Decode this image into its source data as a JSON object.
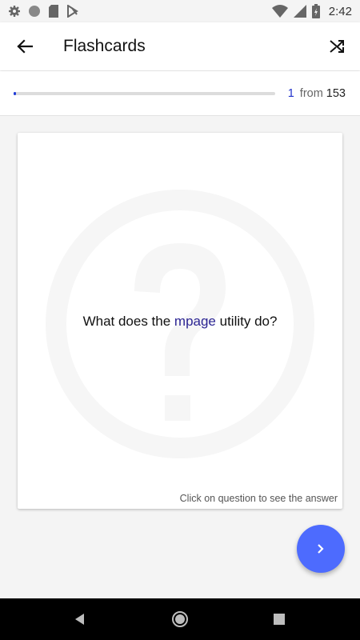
{
  "status_bar": {
    "time": "2:42",
    "icons": [
      "settings-icon",
      "circle-icon",
      "sd-card-icon",
      "app-notification-icon",
      "wifi-icon",
      "signal-icon",
      "battery-icon"
    ]
  },
  "app_bar": {
    "title": "Flashcards",
    "back_icon": "arrow-back-icon",
    "action_icon": "shuffle-icon"
  },
  "progress": {
    "current": "1",
    "from_label": "from",
    "total": "153",
    "fraction": 0.0065,
    "accent_color": "#1f3bd8"
  },
  "card": {
    "question_before": "What does the ",
    "question_term": "mpage",
    "question_after": " utility do?",
    "hint": "Click on question to see the answer",
    "watermark_icon": "question-mark-icon"
  },
  "fab": {
    "icon": "chevron-right-icon",
    "color": "#4d6bfe"
  },
  "nav_bar": {
    "icons": [
      "back-triangle-icon",
      "home-circle-icon",
      "recents-square-icon"
    ]
  }
}
